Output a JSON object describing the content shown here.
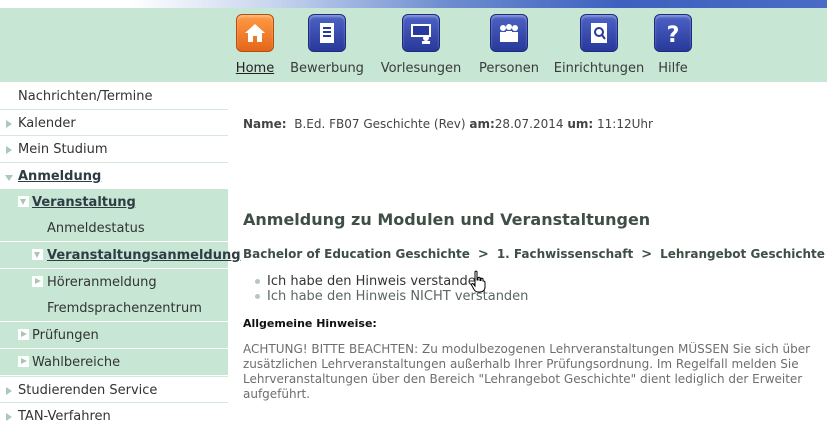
{
  "nav": {
    "items": [
      {
        "label": "Home",
        "icon": "home-icon",
        "active": true
      },
      {
        "label": "Bewerbung",
        "icon": "document-icon"
      },
      {
        "label": "Vorlesungen",
        "icon": "lecture-icon"
      },
      {
        "label": "Personen",
        "icon": "people-icon"
      },
      {
        "label": "Einrichtungen",
        "icon": "building-search-icon"
      },
      {
        "label": "Hilfe",
        "icon": "help-icon"
      }
    ]
  },
  "sidebar": {
    "items": [
      {
        "label": "Nachrichten/Termine"
      },
      {
        "label": "Kalender"
      },
      {
        "label": "Mein Studium"
      },
      {
        "label": "Anmeldung"
      },
      {
        "label": "Veranstaltung"
      },
      {
        "label": "Anmeldestatus"
      },
      {
        "label": "Veranstaltungsanmeldung"
      },
      {
        "label": "Höreranmeldung"
      },
      {
        "label": "Fremdsprachenzentrum"
      },
      {
        "label": "Prüfungen"
      },
      {
        "label": "Wahlbereiche"
      },
      {
        "label": "Studierenden Service"
      },
      {
        "label": "TAN-Verfahren"
      }
    ]
  },
  "info": {
    "name_label": "Name:",
    "name_value": "B.Ed. FB07 Geschichte (Rev)",
    "am_label": "am:",
    "date": "28.07.2014",
    "um_label": "um:",
    "time": "11:12Uhr"
  },
  "main": {
    "title": "Anmeldung zu Modulen und Veranstaltungen",
    "breadcrumb": [
      "Bachelor of Education Geschichte",
      "1. Fachwissenschaft",
      "Lehrangebot Geschichte"
    ],
    "breadcrumb_sep": ">",
    "options": [
      "Ich habe den Hinweis verstanden",
      "Ich habe den Hinweis NICHT verstanden"
    ],
    "hinweise_heading": "Allgemeine Hinweise:",
    "hinweise_lines": [
      "ACHTUNG! BITTE BEACHTEN: Zu modulbezogenen Lehrveranstaltungen MÜSSEN Sie sich über",
      "zusätzlichen Lehrveranstaltungen außerhalb Ihrer Prüfungsordnung. Im Regelfall melden Sie",
      "Lehrveranstaltungen über den Bereich \"Lehrangebot Geschichte\" dient lediglich der Erweiter",
      "aufgeführt."
    ]
  },
  "colors": {
    "header_bg": "#c7e6d4",
    "home_icon": "#f08a3a",
    "nav_icon": "#3347ad",
    "title": "#3f4f46"
  }
}
